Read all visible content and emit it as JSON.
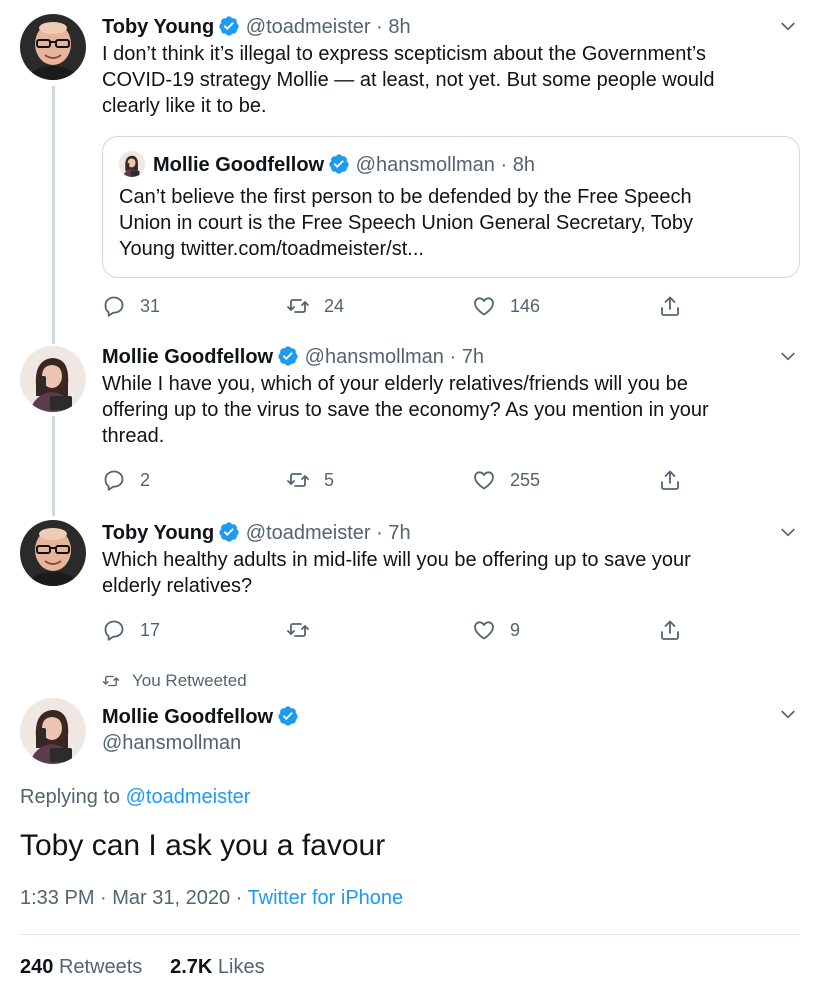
{
  "colors": {
    "accent": "#1d9bf0",
    "muted": "#536471",
    "text": "#0f1419",
    "border": "#cfd9de"
  },
  "tweets": [
    {
      "name": "Toby Young",
      "handle": "@toadmeister",
      "sep": "·",
      "time": "8h",
      "lines": [
        "I don’t think it’s illegal to express scepticism about the Government’s",
        "COVID-19 strategy Mollie — at least, not yet. But some people would",
        "clearly like it to be."
      ],
      "quote": {
        "name": "Mollie Goodfellow",
        "handle": "@hansmollman",
        "sep": "·",
        "time": "8h",
        "lines": [
          "Can’t believe the first person to be defended by the Free Speech",
          "Union in court is the Free Speech Union General Secretary, Toby",
          "Young twitter.com/toadmeister/st..."
        ]
      },
      "replies": "31",
      "retweets": "24",
      "likes": "146"
    },
    {
      "name": "Mollie Goodfellow",
      "handle": "@hansmollman",
      "sep": "·",
      "time": "7h",
      "lines": [
        "While I have you, which of your elderly relatives/friends will you be",
        "offering up to the virus to save the economy? As you mention in your",
        "thread."
      ],
      "replies": "2",
      "retweets": "5",
      "likes": "255"
    },
    {
      "name": "Toby Young",
      "handle": "@toadmeister",
      "sep": "·",
      "time": "7h",
      "lines": [
        "Which healthy adults in mid-life will you be offering up to save your",
        "elderly relatives?"
      ],
      "replies": "17",
      "retweets": "",
      "likes": "9"
    }
  ],
  "main": {
    "social_context": "You Retweeted",
    "name": "Mollie Goodfellow",
    "handle": "@hansmollman",
    "replying_prefix": "Replying to",
    "replying_to": "@toadmeister",
    "text": "Toby can I ask you a favour",
    "timestamp": "1:33 PM · Mar 31, 2020",
    "meta_sep": "·",
    "source": "Twitter for iPhone",
    "retweets_count": "240",
    "retweets_label": "Retweets",
    "likes_count": "2.7K",
    "likes_label": "Likes"
  }
}
